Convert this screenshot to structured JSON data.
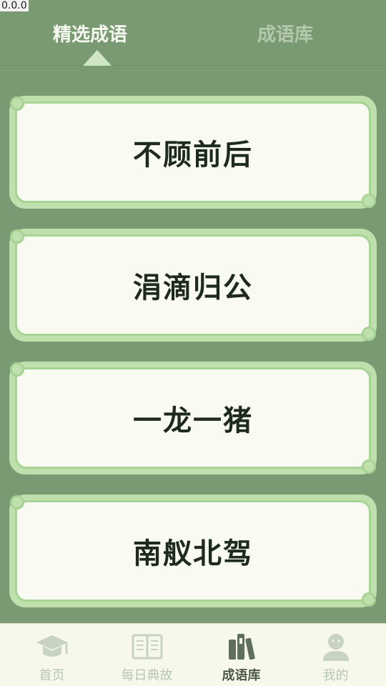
{
  "status": {
    "version": "0.0.0"
  },
  "tabs": [
    {
      "label": "精选成语",
      "active": true
    },
    {
      "label": "成语库",
      "active": false
    }
  ],
  "cards": [
    {
      "text": "不顾前后"
    },
    {
      "text": "涓滴归公"
    },
    {
      "text": "一龙一猪"
    },
    {
      "text": "南舣北驾"
    }
  ],
  "bottom_nav": [
    {
      "label": "首页",
      "icon": "graduation-cap-icon",
      "active": false
    },
    {
      "label": "每日典故",
      "icon": "open-book-icon",
      "active": false
    },
    {
      "label": "成语库",
      "icon": "books-icon",
      "active": true
    },
    {
      "label": "我的",
      "icon": "user-icon",
      "active": false
    }
  ],
  "colors": {
    "background": "#7a9a74",
    "card_border": "#bfe0ad",
    "card_fill": "#f9faf1",
    "active_nav": "#4e5a4c",
    "inactive_nav": "#b8c6b3"
  }
}
